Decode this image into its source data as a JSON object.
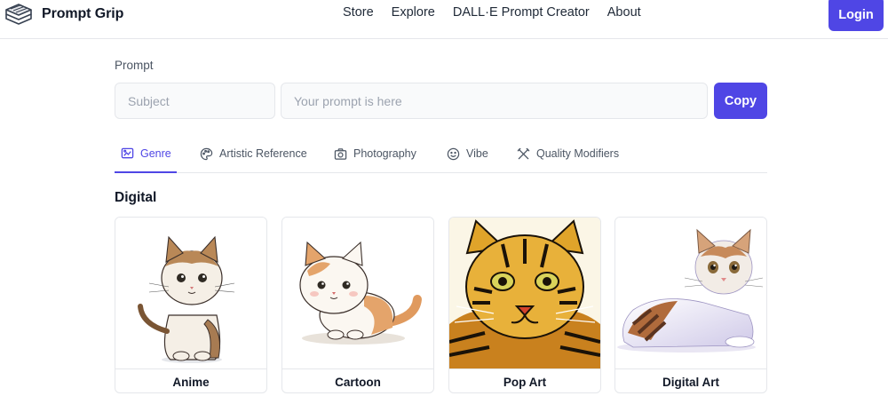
{
  "header": {
    "brand_name": "Prompt Grip",
    "logo_icon": "book-stack-icon",
    "nav": [
      "Store",
      "Explore",
      "DALL·E Prompt Creator",
      "About"
    ],
    "login_label": "Login"
  },
  "prompt": {
    "label": "Prompt",
    "subject_placeholder": "Subject",
    "prompt_placeholder": "Your prompt is here",
    "copy_label": "Copy"
  },
  "tabs": [
    {
      "label": "Genre",
      "icon": "palette-frame-icon",
      "active": true
    },
    {
      "label": "Artistic Reference",
      "icon": "palette-icon",
      "active": false
    },
    {
      "label": "Photography",
      "icon": "camera-icon",
      "active": false
    },
    {
      "label": "Vibe",
      "icon": "smile-icon",
      "active": false
    },
    {
      "label": "Quality Modifiers",
      "icon": "tools-icon",
      "active": false
    }
  ],
  "section": {
    "title": "Digital",
    "cards": [
      {
        "label": "Anime"
      },
      {
        "label": "Cartoon"
      },
      {
        "label": "Pop Art"
      },
      {
        "label": "Digital Art"
      }
    ]
  },
  "colors": {
    "accent": "#4f46e5",
    "border": "#e5e7eb",
    "input_bg": "#f9fafb"
  }
}
